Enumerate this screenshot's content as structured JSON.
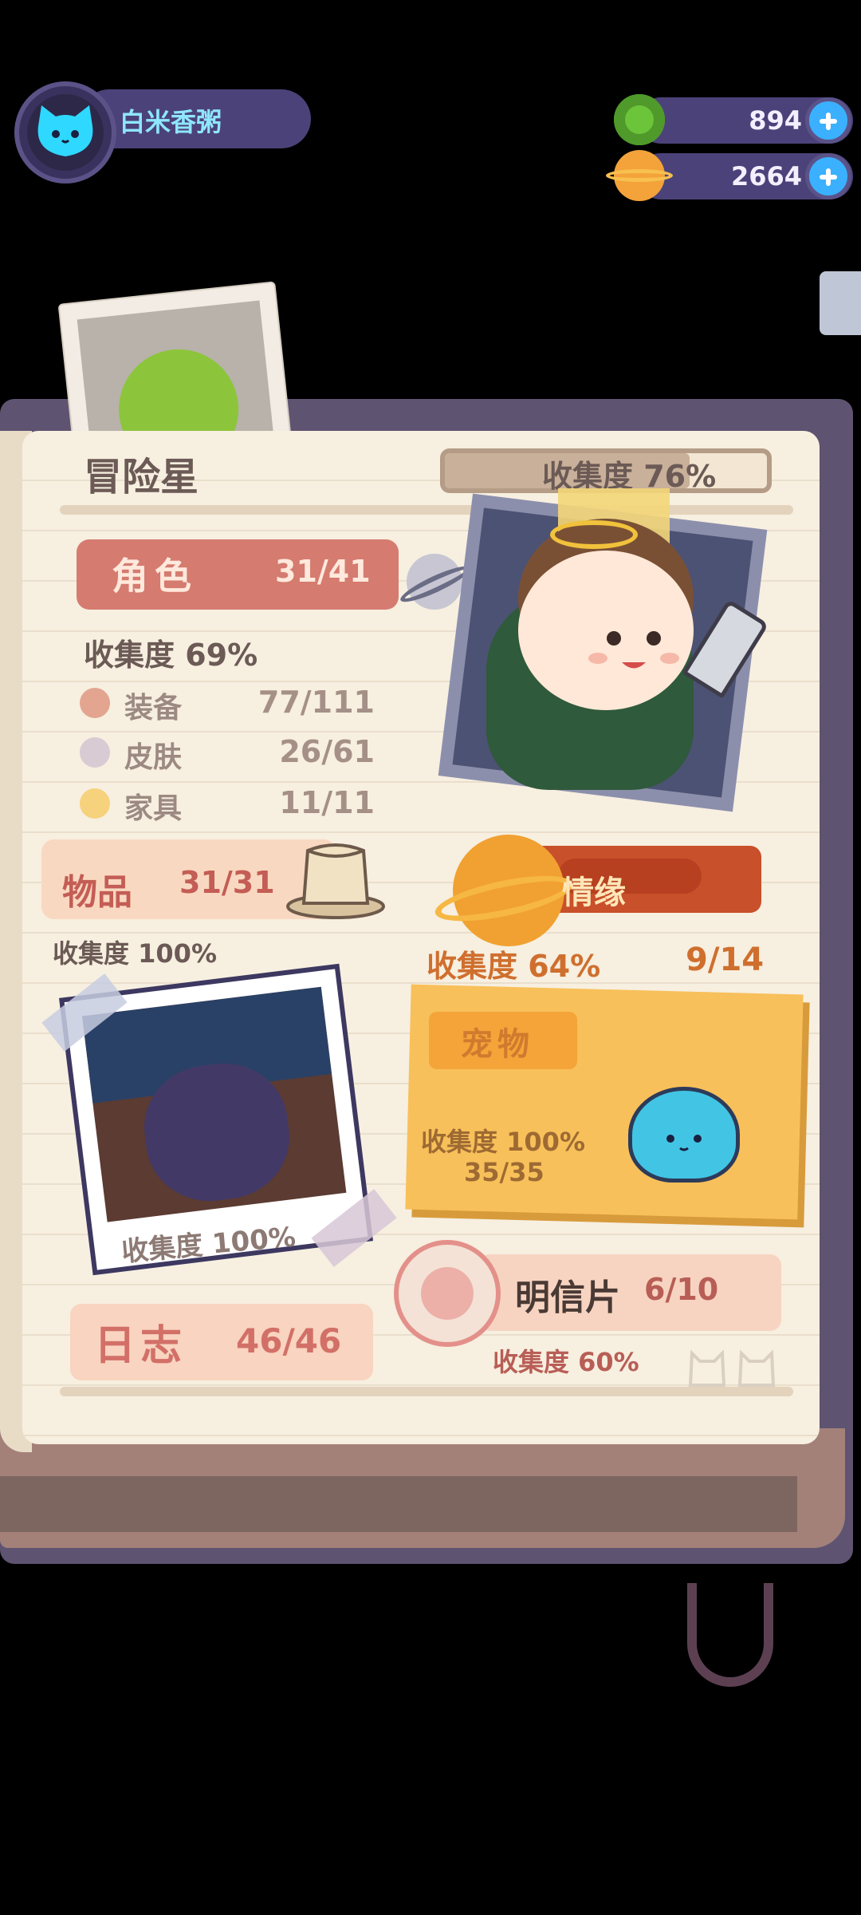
{
  "player": {
    "name": "白米香粥"
  },
  "currency": {
    "donut": {
      "value": "894",
      "icon": "donut-currency-icon"
    },
    "planet": {
      "value": "2664",
      "icon": "planet-coin-icon"
    }
  },
  "book": {
    "title": "冒险星",
    "overall_progress": {
      "label": "收集度 76%",
      "percent": 76
    },
    "roles": {
      "label": "角色",
      "count": "31/41",
      "collection": "收集度 69%",
      "subcategories": [
        {
          "label": "装备",
          "count": "77/111",
          "color": "#e3a58f"
        },
        {
          "label": "皮肤",
          "count": "26/61",
          "color": "#d9cbd3"
        },
        {
          "label": "家具",
          "count": "11/11",
          "color": "#f6d27c"
        }
      ]
    },
    "items": {
      "label": "物品",
      "count": "31/31",
      "collection": "收集度 100%"
    },
    "relationship": {
      "label": "情缘",
      "collection": "收集度 64%",
      "count": "9/14"
    },
    "journal_photo": {
      "collection": "收集度 100%"
    },
    "pets": {
      "label": "宠物",
      "collection": "收集度 100%",
      "count": "35/35"
    },
    "postcards": {
      "label": "明信片",
      "count": "6/10",
      "collection": "收集度 60%"
    },
    "journal": {
      "label": "日志",
      "count": "46/46"
    }
  }
}
